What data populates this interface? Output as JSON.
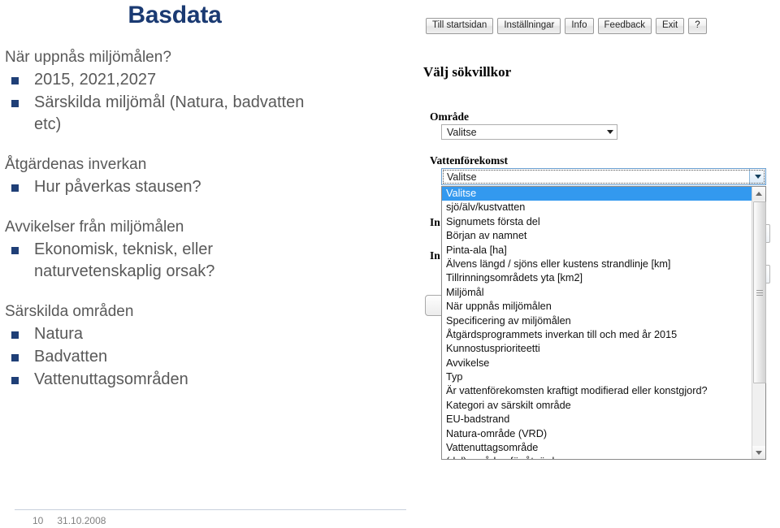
{
  "slide": {
    "title": "Basdata",
    "sections": [
      {
        "heading": "När uppnås miljömålen?",
        "bullets": [
          "2015, 2021,2027",
          "Särskilda miljömål (Natura, badvatten etc)"
        ]
      },
      {
        "heading": "Åtgärdenas inverkan",
        "bullets": [
          "Hur påverkas stausen?"
        ]
      },
      {
        "heading": "Avvikelser från miljömålen",
        "bullets": [
          "Ekonomisk, teknisk, eller naturvetenskaplig orsak?"
        ]
      },
      {
        "heading": "Särskilda områden",
        "bullets": [
          "Natura",
          "Badvatten",
          "Vattenuttagsområden"
        ]
      }
    ],
    "footer": {
      "page_number": "10",
      "date": "31.10.2008"
    },
    "colors": {
      "title": "#1a3a72",
      "bullet_square": "#1f3f77",
      "body_text": "#595959"
    }
  },
  "app": {
    "toolbar": {
      "buttons": [
        "Till startsidan",
        "Inställningar",
        "Info",
        "Feedback",
        "Exit",
        "?"
      ]
    },
    "panel_heading": "Välj sökvillkor",
    "fields": {
      "omrade_label": "Område",
      "omrade_value": "Valitse",
      "vattenforekomst_label": "Vattenförekomst",
      "vattenforekomst_value": "Valitse",
      "hidden_label_1": "In",
      "hidden_label_2": "In"
    },
    "dropdown": {
      "selected": "Valitse",
      "items": [
        "Valitse",
        "sjö/älv/kustvatten",
        "Signumets första del",
        "Början av namnet",
        "Pinta-ala [ha]",
        "Älvens längd / sjöns eller kustens strandlinje [km]",
        "Tillrinningsområdets yta [km2]",
        "Miljömål",
        "När uppnås miljömålen",
        "Specificering av miljömålen",
        "Åtgärdsprogrammets inverkan till och med år 2015",
        "Kunnostusprioriteetti",
        "Avvikelse",
        "Typ",
        "Är vattenförekomsten kraftigt modifierad eller konstgjord?",
        "Kategori av särskilt område",
        "EU-badstrand",
        "Natura-område (VRD)",
        "Vattenuttagsområde",
        "(del)områden för åtgärdsprogram"
      ]
    },
    "colors": {
      "selection": "#3399ef",
      "combo_border": "#adadad"
    }
  }
}
